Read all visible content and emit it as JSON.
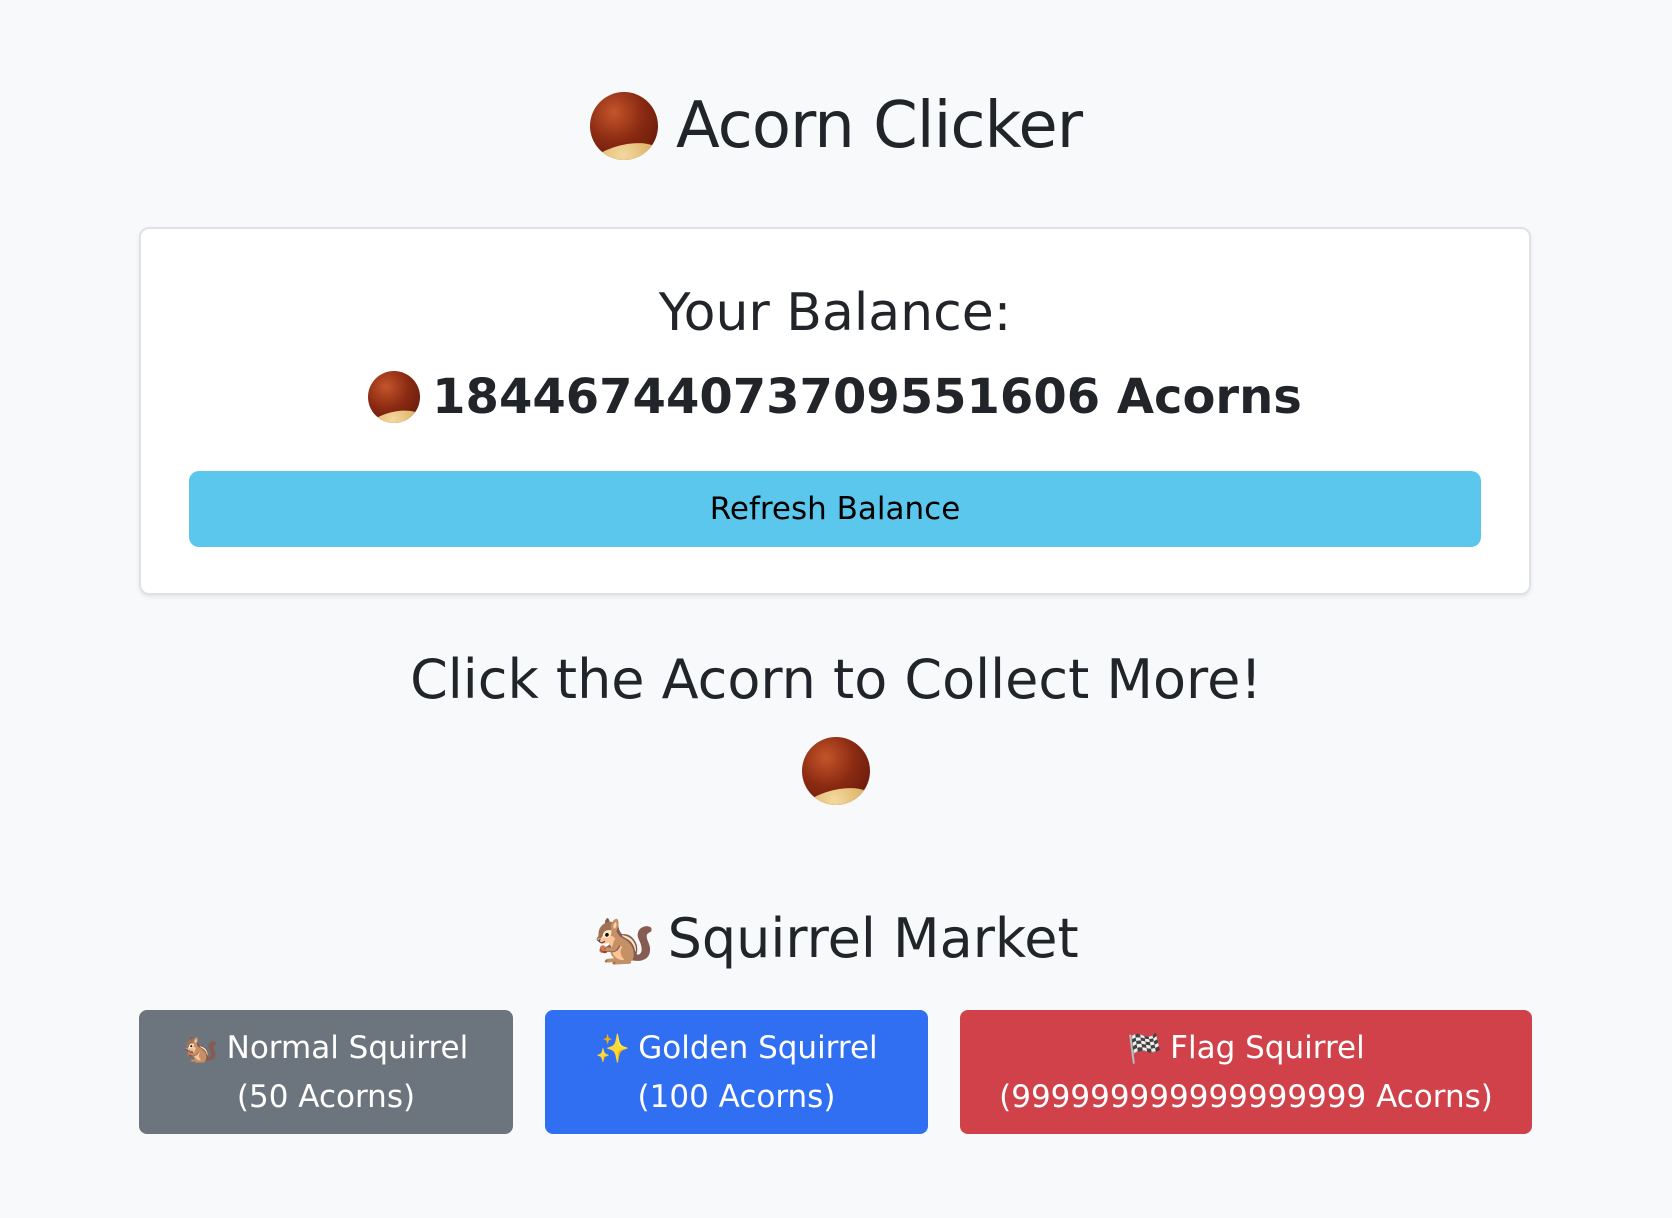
{
  "app": {
    "title": "Acorn Clicker"
  },
  "balance": {
    "label": "Your Balance:",
    "amount": "18446744073709551606 Acorns",
    "refresh_label": "Refresh Balance"
  },
  "clicker": {
    "heading": "Click the Acorn to Collect More!"
  },
  "market": {
    "title": "Squirrel Market",
    "title_icon": "🐿️",
    "items": [
      {
        "icon": "🐿️",
        "name": "Normal Squirrel",
        "price": "(50 Acorns)",
        "color": "#6c757d"
      },
      {
        "icon": "✨",
        "name": "Golden Squirrel",
        "price": "(100 Acorns)",
        "color": "#316ff2"
      },
      {
        "icon": "🏁",
        "name": "Flag Squirrel",
        "price": "(999999999999999999 Acorns)",
        "color": "#d0414a"
      }
    ]
  },
  "icons": {
    "acorn": "acorn-icon",
    "squirrel": "squirrel-icon",
    "sparkles": "sparkles-icon",
    "checkered_flag": "checkered-flag-icon"
  }
}
